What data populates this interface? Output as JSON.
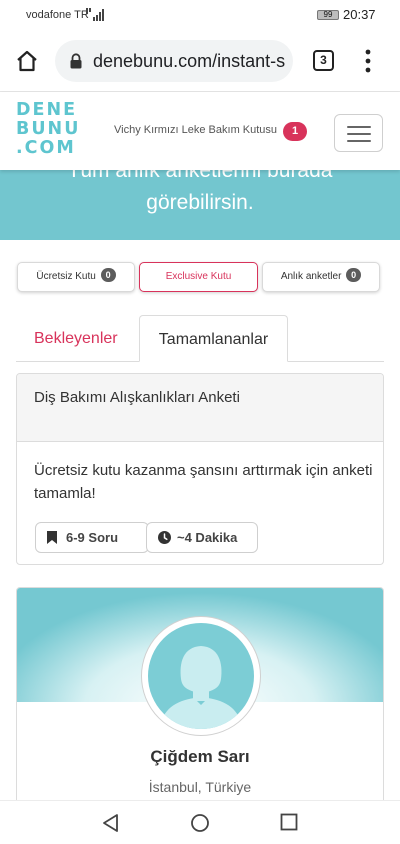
{
  "status_bar": {
    "carrier": "vodafone TR",
    "battery": "99",
    "time": "20:37"
  },
  "browser": {
    "url": "denebunu.com/instant-s",
    "tab_count": "3"
  },
  "header": {
    "logo_lines": [
      "DENE",
      "BUNU",
      ".COM"
    ],
    "product_name": "Vichy Kırmızı Leke Bakım Kutusu",
    "product_count": "1"
  },
  "hero": {
    "line1": "Tüm anlık anketlerini burada",
    "line2": "görebilirsin."
  },
  "filters": {
    "free": {
      "label": "Ücretsiz Kutu",
      "count": "0"
    },
    "exclusive": {
      "label": "Exclusive Kutu"
    },
    "instant": {
      "label": "Anlık anketler",
      "count": "0"
    }
  },
  "tabs": {
    "pending": "Bekleyenler",
    "completed": "Tamamlananlar"
  },
  "survey": {
    "title": "Diş Bakımı Alışkanlıkları Anketi",
    "description": "Ücretsiz kutu kazanma şansını arttırmak için anketi tamamla!",
    "questions": "6-9 Soru",
    "duration": "~4 Dakika"
  },
  "profile": {
    "name": "Çiğdem Sarı",
    "location": "İstanbul, Türkiye"
  },
  "colors": {
    "accent_pink": "#d8335b",
    "teal": "#73c6cf"
  }
}
